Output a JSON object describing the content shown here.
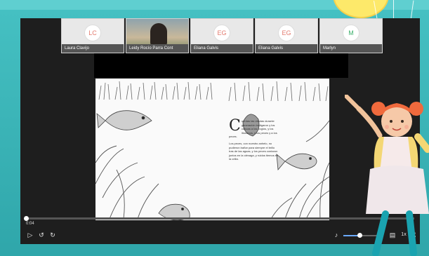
{
  "participants": [
    {
      "initials": "LC",
      "name": "Laura Clavijo",
      "color": "#e37b6f",
      "video": false
    },
    {
      "initials": "",
      "name": "Leidy Rocío Parra Cont",
      "color": "",
      "video": true
    },
    {
      "initials": "EG",
      "name": "Eliana Galvis",
      "color": "#e37b6f",
      "video": false
    },
    {
      "initials": "EG",
      "name": "Eliana Galvis",
      "color": "#e37b6f",
      "video": false
    },
    {
      "initials": "M",
      "name": "Marlyn",
      "color": "#3caf6b",
      "video": false
    }
  ],
  "book": {
    "dropcap": "C",
    "paragraph1": "uerdas las olladas durante generación instigaron y los canoas a los cogios, y los litorianos, y los peces y a los peces.",
    "paragraph2": "Los peces, con nuestro anhelo, no pudieron bañar para siempre el brillo tras de las aguas, y los peces contaron juntos en la ciénaga, y ruidos tiemos en la orilla."
  },
  "player": {
    "timecode": "0:04",
    "progress": 0.0,
    "volume": 0.45,
    "icons": [
      "play-icon",
      "replay-icon",
      "forward-icon",
      "volume-icon",
      "captions-icon",
      "speed-icon",
      "fullscreen-icon"
    ],
    "speed_label": "1x"
  },
  "colors": {
    "frame": "#39b3b6",
    "player_bg": "#1e1e1e",
    "sun": "#fde96a"
  }
}
